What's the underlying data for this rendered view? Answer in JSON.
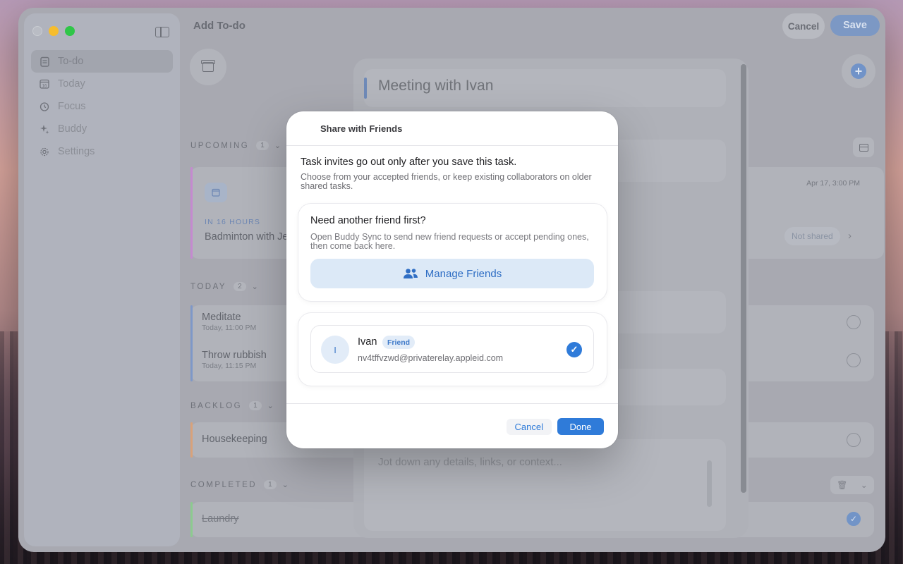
{
  "window": {
    "title": "Add To-do",
    "cancel_label": "Cancel",
    "save_label": "Save"
  },
  "sidebar": {
    "items": [
      {
        "label": "To-do",
        "icon": "clipboard-icon",
        "active": true
      },
      {
        "label": "Today",
        "icon": "calendar-16-icon"
      },
      {
        "label": "Focus",
        "icon": "timer-icon"
      },
      {
        "label": "Buddy",
        "icon": "sparkle-icon"
      },
      {
        "label": "Settings",
        "icon": "gear-icon"
      }
    ]
  },
  "sections": {
    "upcoming": {
      "label": "UPCOMING",
      "count": "1"
    },
    "today": {
      "label": "TODAY",
      "count": "2"
    },
    "backlog": {
      "label": "BACKLOG",
      "count": "1"
    },
    "completed": {
      "label": "COMPLETED",
      "count": "1"
    }
  },
  "tasks": {
    "upcoming_eta": "IN 16 HOURS",
    "upcoming_title": "Badminton with Je",
    "upcoming_date": "Apr 17, 3:00 PM",
    "upcoming_share": "Not shared",
    "meditate_title": "Meditate",
    "meditate_time": "Today, 11:00 PM",
    "rubbish_title": "Throw rubbish",
    "rubbish_time": "Today, 11:15 PM",
    "housekeeping_title": "Housekeeping",
    "laundry_title": "Laundry"
  },
  "editor": {
    "title": "Meeting with Ivan",
    "notes_placeholder": "Jot down any details, links, or context..."
  },
  "modal": {
    "title": "Share with Friends",
    "headline": "Task invites go out only after you save this task.",
    "subtext": "Choose from your accepted friends, or keep existing collaborators on older shared tasks.",
    "need_friend_title": "Need another friend first?",
    "need_friend_sub": "Open Buddy Sync to send new friend requests or accept pending ones, then come back here.",
    "manage_label": "Manage Friends",
    "friend": {
      "initial": "I",
      "name": "Ivan",
      "badge": "Friend",
      "email": "nv4tffvzwd@privaterelay.appleid.com",
      "selected": true
    },
    "cancel_label": "Cancel",
    "done_label": "Done"
  },
  "colors": {
    "accent": "#2f7bd9",
    "upcoming_strip": "#c58ad0",
    "today_strip": "#7e98c8",
    "backlog_strip": "#d9a27a",
    "completed_strip": "#8ccb8f"
  }
}
